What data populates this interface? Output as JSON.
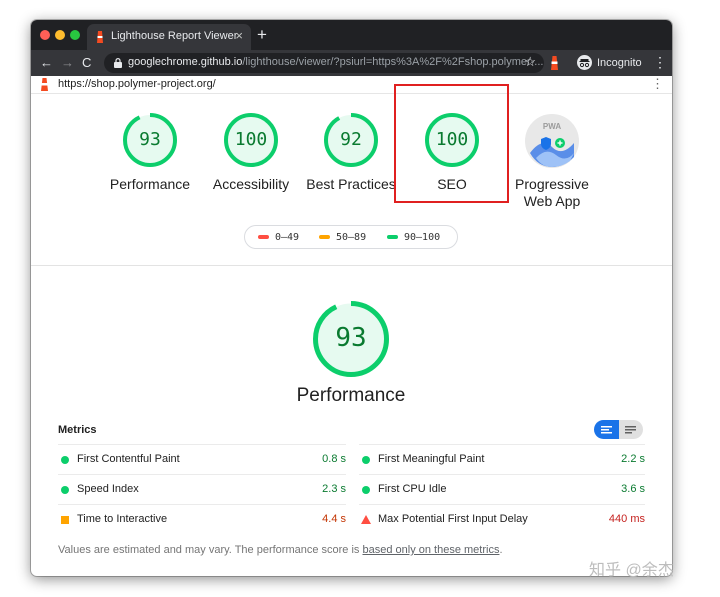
{
  "browser": {
    "tab_title": "Lighthouse Report Viewer",
    "tab_close": "×",
    "new_tab": "+",
    "nav_back": "←",
    "nav_forward": "→",
    "reload": "C",
    "url_host": "googlechrome.github.io",
    "url_path": "/lighthouse/viewer/?psiurl=https%3A%2F%2Fshop.polymer-...",
    "bookmark_star": "☆",
    "incognito_label": "Incognito",
    "menu": "⋮"
  },
  "report": {
    "audited_url": "https://shop.polymer-project.org/",
    "menu": "⋮",
    "categories": [
      {
        "label": "Performance",
        "score": "93",
        "value": 0.93
      },
      {
        "label": "Accessibility",
        "score": "100",
        "value": 1.0
      },
      {
        "label": "Best Practices",
        "score": "92",
        "value": 0.92
      },
      {
        "label": "SEO",
        "score": "100",
        "value": 1.0
      },
      {
        "label_line1": "Progressive",
        "label_line2": "Web App",
        "badge_text": "PWA"
      }
    ],
    "legend": [
      {
        "range": "0–49",
        "color": "#ff4e42"
      },
      {
        "range": "50–89",
        "color": "#ffa400"
      },
      {
        "range": "90–100",
        "color": "#0cce6b"
      }
    ],
    "main_score": "93",
    "main_value": 0.93,
    "main_title": "Performance",
    "metrics_title": "Metrics",
    "metrics_left": [
      {
        "label": "First Contentful Paint",
        "value": "0.8 s"
      },
      {
        "label": "Speed Index",
        "value": "2.3 s"
      },
      {
        "label": "Time to Interactive",
        "value": "4.4 s"
      }
    ],
    "metrics_right": [
      {
        "label": "First Meaningful Paint",
        "value": "2.2 s"
      },
      {
        "label": "First CPU Idle",
        "value": "3.6 s"
      },
      {
        "label": "Max Potential First Input Delay",
        "value": "440 ms"
      }
    ],
    "footnote_text": "Values are estimated and may vary. The performance score is ",
    "footnote_link": "based only on these metrics",
    "footnote_end": ".",
    "colors": {
      "pass": "#0cce6b",
      "average": "#ffa400",
      "fail": "#ff4e42"
    }
  },
  "watermark": "知乎 @余杰"
}
